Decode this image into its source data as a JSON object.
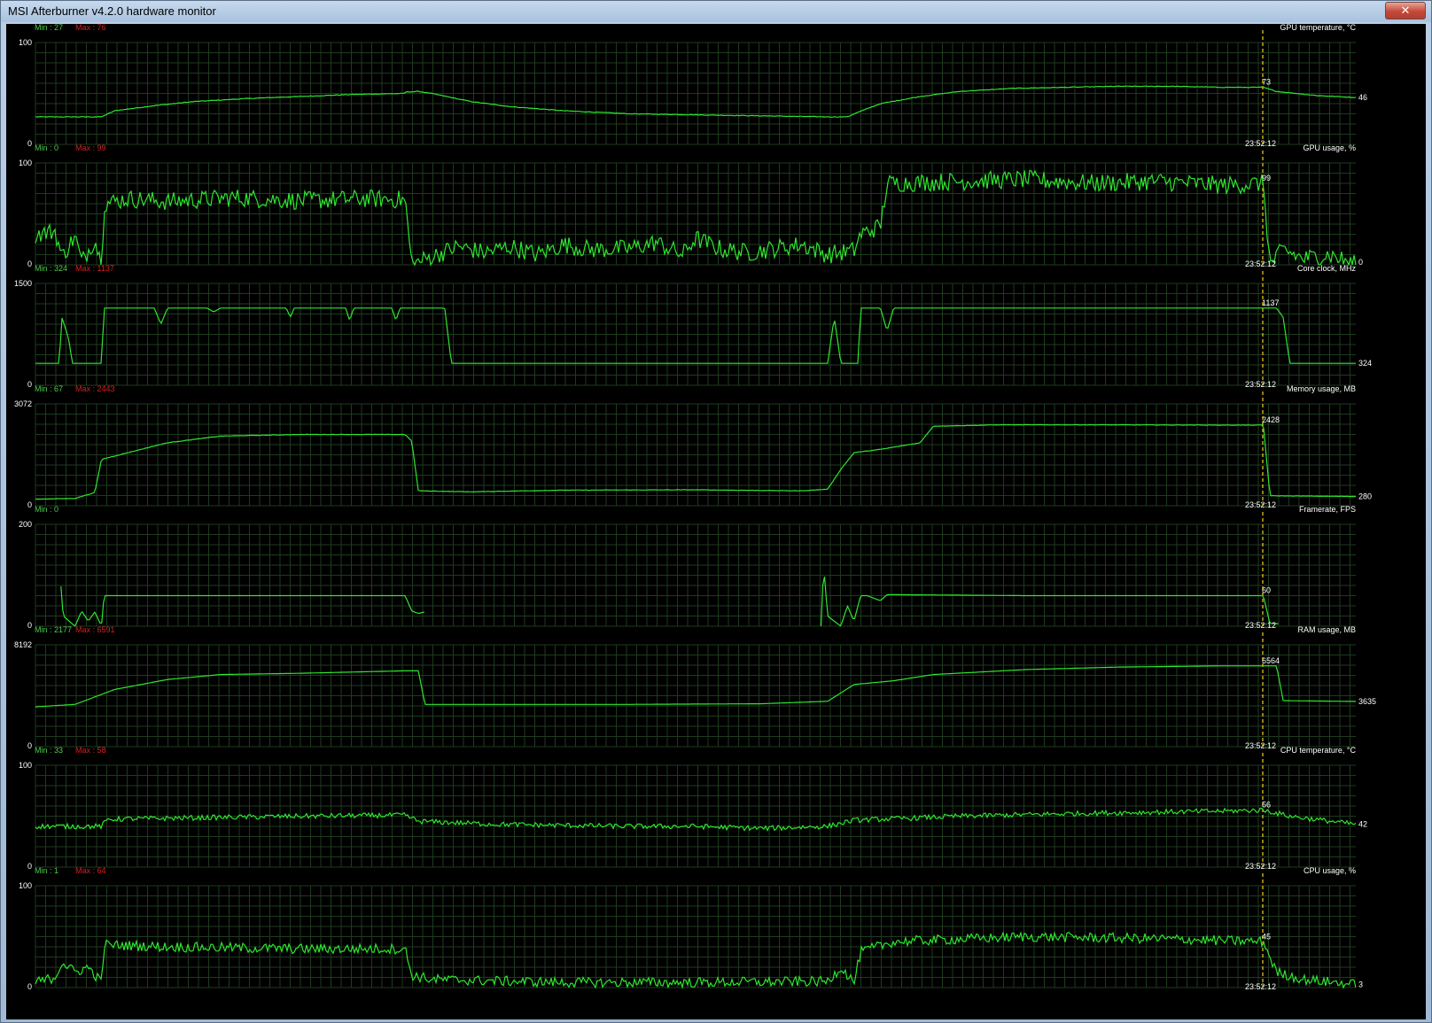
{
  "window": {
    "title": "MSI Afterburner v4.2.0 hardware monitor",
    "close_glyph": "✕"
  },
  "colors": {
    "background": "#000000",
    "grid": "#1f3a1f",
    "line": "#2ee62e",
    "cursor": "#e0c020",
    "min_label": "#4ecd4e",
    "max_label": "#d42020",
    "text": "#ffffff"
  },
  "cursor_time": "23:52:12",
  "graphs": [
    {
      "name": "GPU temperature, °C",
      "ymax_label": "100",
      "ymin_label": "0",
      "ymin": 0,
      "ymax": 100,
      "min_label": "Min : 27",
      "max_label": "Max : 76",
      "cursor_value": "73",
      "end_value": "46",
      "noise": 0.3,
      "points": [
        [
          0,
          27
        ],
        [
          0.05,
          27
        ],
        [
          0.06,
          33
        ],
        [
          0.09,
          38
        ],
        [
          0.12,
          42
        ],
        [
          0.16,
          45
        ],
        [
          0.2,
          47
        ],
        [
          0.24,
          49
        ],
        [
          0.28,
          50
        ],
        [
          0.275,
          51
        ],
        [
          0.29,
          52
        ],
        [
          0.3,
          50
        ],
        [
          0.33,
          42
        ],
        [
          0.36,
          37
        ],
        [
          0.4,
          33
        ],
        [
          0.45,
          30
        ],
        [
          0.5,
          29
        ],
        [
          0.55,
          28
        ],
        [
          0.6,
          27
        ],
        [
          0.615,
          27
        ],
        [
          0.62,
          30
        ],
        [
          0.64,
          40
        ],
        [
          0.67,
          47
        ],
        [
          0.7,
          52
        ],
        [
          0.74,
          55
        ],
        [
          0.78,
          56
        ],
        [
          0.82,
          57
        ],
        [
          0.86,
          57
        ],
        [
          0.9,
          56
        ],
        [
          0.93,
          56
        ],
        [
          0.94,
          52
        ],
        [
          0.97,
          48
        ],
        [
          1,
          46
        ]
      ]
    },
    {
      "name": "GPU usage, %",
      "ymax_label": "100",
      "ymin_label": "0",
      "ymin": 0,
      "ymax": 100,
      "min_label": "Min : 0",
      "max_label": "Max : 99",
      "cursor_value": "99",
      "end_value": "0",
      "noise": 9,
      "points": [
        [
          0,
          30
        ],
        [
          0.015,
          33
        ],
        [
          0.02,
          8
        ],
        [
          0.03,
          28
        ],
        [
          0.035,
          3
        ],
        [
          0.045,
          25
        ],
        [
          0.05,
          0
        ],
        [
          0.052,
          60
        ],
        [
          0.07,
          65
        ],
        [
          0.1,
          62
        ],
        [
          0.15,
          66
        ],
        [
          0.2,
          63
        ],
        [
          0.25,
          65
        ],
        [
          0.28,
          64
        ],
        [
          0.285,
          0
        ],
        [
          0.3,
          8
        ],
        [
          0.32,
          18
        ],
        [
          0.34,
          12
        ],
        [
          0.36,
          18
        ],
        [
          0.38,
          10
        ],
        [
          0.4,
          20
        ],
        [
          0.42,
          15
        ],
        [
          0.45,
          16
        ],
        [
          0.47,
          22
        ],
        [
          0.49,
          10
        ],
        [
          0.5,
          26
        ],
        [
          0.52,
          15
        ],
        [
          0.54,
          12
        ],
        [
          0.56,
          16
        ],
        [
          0.58,
          20
        ],
        [
          0.6,
          10
        ],
        [
          0.62,
          14
        ],
        [
          0.625,
          30
        ],
        [
          0.64,
          38
        ],
        [
          0.645,
          80
        ],
        [
          0.7,
          82
        ],
        [
          0.75,
          84
        ],
        [
          0.8,
          80
        ],
        [
          0.85,
          82
        ],
        [
          0.9,
          78
        ],
        [
          0.93,
          80
        ],
        [
          0.935,
          0
        ],
        [
          0.945,
          15
        ],
        [
          0.96,
          6
        ],
        [
          0.98,
          10
        ],
        [
          1,
          0
        ]
      ]
    },
    {
      "name": "Core clock, MHz",
      "ymax_label": "1500",
      "ymin_label": "0",
      "ymin": 0,
      "ymax": 1500,
      "min_label": "Min : 324",
      "max_label": "Max : 1137",
      "cursor_value": "1137",
      "end_value": "324",
      "noise": 0,
      "points": [
        [
          0,
          324
        ],
        [
          0.018,
          324
        ],
        [
          0.02,
          1000
        ],
        [
          0.025,
          700
        ],
        [
          0.028,
          324
        ],
        [
          0.05,
          324
        ],
        [
          0.052,
          1137
        ],
        [
          0.09,
          1137
        ],
        [
          0.095,
          900
        ],
        [
          0.1,
          1137
        ],
        [
          0.13,
          1137
        ],
        [
          0.135,
          1080
        ],
        [
          0.14,
          1137
        ],
        [
          0.19,
          1137
        ],
        [
          0.193,
          1000
        ],
        [
          0.196,
          1137
        ],
        [
          0.235,
          1137
        ],
        [
          0.238,
          950
        ],
        [
          0.241,
          1137
        ],
        [
          0.27,
          1137
        ],
        [
          0.273,
          950
        ],
        [
          0.276,
          1137
        ],
        [
          0.31,
          1137
        ],
        [
          0.315,
          324
        ],
        [
          0.6,
          324
        ],
        [
          0.605,
          1000
        ],
        [
          0.61,
          324
        ],
        [
          0.623,
          324
        ],
        [
          0.625,
          1137
        ],
        [
          0.64,
          1137
        ],
        [
          0.645,
          800
        ],
        [
          0.65,
          1137
        ],
        [
          0.94,
          1137
        ],
        [
          0.945,
          1000
        ],
        [
          0.95,
          324
        ],
        [
          1,
          324
        ]
      ]
    },
    {
      "name": "Memory usage, MB",
      "ymax_label": "3072",
      "ymin_label": "0",
      "ymin": 0,
      "ymax": 3072,
      "min_label": "Min : 67",
      "max_label": "Max : 2443",
      "cursor_value": "2428",
      "end_value": "280",
      "noise": 6,
      "points": [
        [
          0,
          200
        ],
        [
          0.03,
          220
        ],
        [
          0.045,
          400
        ],
        [
          0.05,
          1400
        ],
        [
          0.07,
          1600
        ],
        [
          0.1,
          1900
        ],
        [
          0.14,
          2100
        ],
        [
          0.2,
          2150
        ],
        [
          0.28,
          2150
        ],
        [
          0.285,
          1950
        ],
        [
          0.29,
          450
        ],
        [
          0.33,
          420
        ],
        [
          0.4,
          470
        ],
        [
          0.5,
          480
        ],
        [
          0.58,
          450
        ],
        [
          0.6,
          500
        ],
        [
          0.61,
          1100
        ],
        [
          0.62,
          1600
        ],
        [
          0.64,
          1700
        ],
        [
          0.67,
          1900
        ],
        [
          0.68,
          2400
        ],
        [
          0.73,
          2440
        ],
        [
          0.8,
          2440
        ],
        [
          0.93,
          2430
        ],
        [
          0.935,
          300
        ],
        [
          1,
          280
        ]
      ]
    },
    {
      "name": "Framerate, FPS",
      "ymax_label": "200",
      "ymin_label": "0",
      "ymin": 0,
      "ymax": 200,
      "min_label": "Min : 0",
      "max_label": "",
      "cursor_value": "60",
      "end_value": "",
      "noise": 0,
      "points": [
        [
          0.018,
          0
        ],
        [
          0.019,
          90
        ],
        [
          0.021,
          20
        ],
        [
          0.03,
          0
        ],
        [
          0.035,
          30
        ],
        [
          0.04,
          10
        ],
        [
          0.045,
          28
        ],
        [
          0.05,
          0
        ],
        [
          0.052,
          60
        ],
        [
          0.28,
          60
        ],
        [
          0.285,
          30
        ],
        [
          0.29,
          25
        ],
        [
          0.295,
          28
        ]
      ],
      "points2": [
        [
          0.595,
          0
        ],
        [
          0.597,
          120
        ],
        [
          0.6,
          20
        ],
        [
          0.61,
          0
        ],
        [
          0.615,
          40
        ],
        [
          0.62,
          10
        ],
        [
          0.625,
          60
        ],
        [
          0.63,
          60
        ],
        [
          0.64,
          50
        ],
        [
          0.645,
          62
        ],
        [
          0.75,
          60
        ],
        [
          0.8,
          60
        ],
        [
          0.93,
          60
        ],
        [
          0.935,
          5
        ],
        [
          0.942,
          5
        ]
      ]
    },
    {
      "name": "RAM usage, MB",
      "ymax_label": "8192",
      "ymin_label": "0",
      "ymin": 0,
      "ymax": 8192,
      "min_label": "Min : 2177",
      "max_label": "Max : 6591",
      "cursor_value": "6564",
      "end_value": "3635",
      "noise": 0,
      "points": [
        [
          0,
          3200
        ],
        [
          0.03,
          3400
        ],
        [
          0.06,
          4600
        ],
        [
          0.1,
          5400
        ],
        [
          0.14,
          5800
        ],
        [
          0.2,
          5900
        ],
        [
          0.28,
          6100
        ],
        [
          0.29,
          6100
        ],
        [
          0.295,
          3400
        ],
        [
          0.35,
          3400
        ],
        [
          0.45,
          3400
        ],
        [
          0.55,
          3450
        ],
        [
          0.6,
          3650
        ],
        [
          0.62,
          5000
        ],
        [
          0.65,
          5300
        ],
        [
          0.68,
          5800
        ],
        [
          0.75,
          6200
        ],
        [
          0.82,
          6400
        ],
        [
          0.9,
          6500
        ],
        [
          0.94,
          6500
        ],
        [
          0.945,
          3700
        ],
        [
          1,
          3635
        ]
      ]
    },
    {
      "name": "CPU temperature, °C",
      "ymax_label": "100",
      "ymin_label": "0",
      "ymin": 0,
      "ymax": 100,
      "min_label": "Min : 33",
      "max_label": "Max : 58",
      "cursor_value": "56",
      "end_value": "42",
      "noise": 2.5,
      "points": [
        [
          0,
          40
        ],
        [
          0.05,
          40
        ],
        [
          0.055,
          47
        ],
        [
          0.1,
          48
        ],
        [
          0.2,
          50
        ],
        [
          0.28,
          51
        ],
        [
          0.29,
          45
        ],
        [
          0.35,
          42
        ],
        [
          0.45,
          40
        ],
        [
          0.5,
          40
        ],
        [
          0.55,
          38
        ],
        [
          0.6,
          40
        ],
        [
          0.62,
          46
        ],
        [
          0.7,
          50
        ],
        [
          0.8,
          53
        ],
        [
          0.9,
          55
        ],
        [
          0.93,
          56
        ],
        [
          0.95,
          50
        ],
        [
          1,
          42
        ]
      ]
    },
    {
      "name": "CPU usage, %",
      "ymax_label": "100",
      "ymin_label": "0",
      "ymin": 0,
      "ymax": 100,
      "min_label": "Min : 1",
      "max_label": "Max : 64",
      "cursor_value": "45",
      "end_value": "3",
      "noise": 5,
      "points": [
        [
          0,
          5
        ],
        [
          0.015,
          10
        ],
        [
          0.02,
          25
        ],
        [
          0.03,
          15
        ],
        [
          0.04,
          20
        ],
        [
          0.05,
          5
        ],
        [
          0.052,
          42
        ],
        [
          0.1,
          40
        ],
        [
          0.2,
          38
        ],
        [
          0.28,
          38
        ],
        [
          0.285,
          12
        ],
        [
          0.3,
          8
        ],
        [
          0.4,
          5
        ],
        [
          0.5,
          5
        ],
        [
          0.6,
          6
        ],
        [
          0.61,
          20
        ],
        [
          0.62,
          5
        ],
        [
          0.625,
          35
        ],
        [
          0.65,
          45
        ],
        [
          0.75,
          50
        ],
        [
          0.85,
          48
        ],
        [
          0.93,
          45
        ],
        [
          0.94,
          15
        ],
        [
          0.96,
          8
        ],
        [
          1,
          3
        ]
      ]
    }
  ]
}
